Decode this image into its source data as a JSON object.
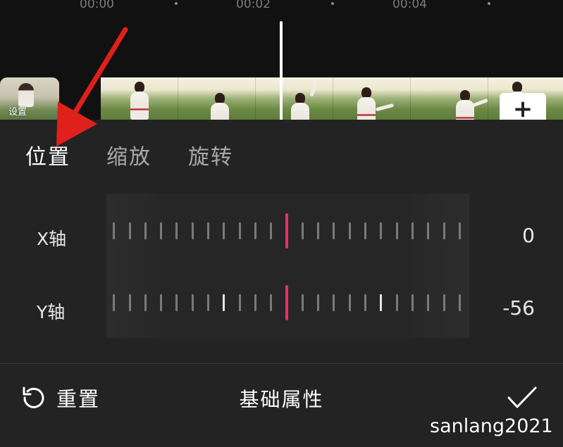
{
  "timeline": {
    "time_labels": [
      "00:00",
      "00:02",
      "00:04"
    ],
    "cover_label": "设置"
  },
  "tabs": [
    {
      "label": "位置",
      "active": true
    },
    {
      "label": "缩放",
      "active": false
    },
    {
      "label": "旋转",
      "active": false
    }
  ],
  "adjustments": {
    "x_axis": {
      "label": "X轴",
      "value": "0"
    },
    "y_axis": {
      "label": "Y轴",
      "value": "-56"
    }
  },
  "footer": {
    "reset_label": "重置",
    "title": "基础属性"
  },
  "watermark": "sanlang2021",
  "colors": {
    "accent": "#e8335f",
    "annotation_arrow": "#e0201b",
    "background": "#232323",
    "timeline_background": "#111111"
  },
  "icons": {
    "reset": "reset-icon",
    "confirm": "checkmark-icon",
    "add": "plus-icon"
  }
}
